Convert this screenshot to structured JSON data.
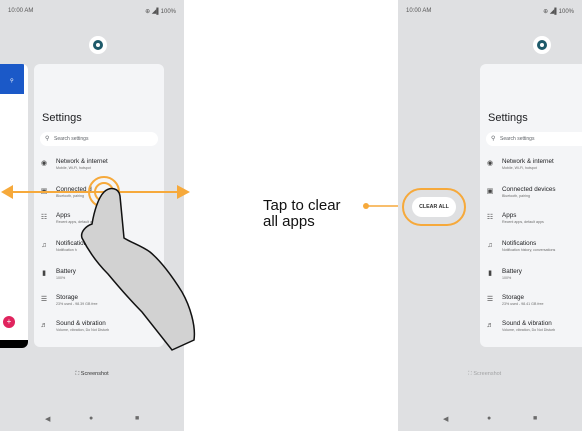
{
  "status": {
    "time": "10:00 AM",
    "icons": "⊕ ◢▌100%"
  },
  "settings": {
    "title": "Settings",
    "search_placeholder": "Search settings",
    "items": [
      {
        "title": "Network & internet",
        "subtitle": "Mobile, Wi-Fi, hotspot",
        "icon": "wifi-icon"
      },
      {
        "title": "Connected devices",
        "subtitle": "Bluetooth, pairing",
        "icon": "devices-icon"
      },
      {
        "title": "Apps",
        "subtitle": "Recent apps, default apps",
        "icon": "apps-icon"
      },
      {
        "title": "Notifications",
        "subtitle": "Notification history, conversations",
        "icon": "bell-icon"
      },
      {
        "title": "Battery",
        "subtitle": "100%",
        "icon": "battery-icon"
      },
      {
        "title": "Storage",
        "subtitle": "23% used - 98.39 GB free",
        "icon": "storage-icon"
      },
      {
        "title": "Sound & vibration",
        "subtitle": "Volume, vibration, Do Not Disturb",
        "icon": "sound-icon"
      }
    ]
  },
  "left_partial": {
    "connected_title": "Connected d",
    "connected_subtitle": "Bluetooth, pairing",
    "notifications_subtitle": "Notification h"
  },
  "right_partial": {
    "storage_subtitle": "23% used - 98.41 GB free"
  },
  "screenshot_label": "Screenshot",
  "clear_all_label": "CLEAR ALL",
  "callout": {
    "line1": "Tap to clear",
    "line2": "all apps"
  },
  "colors": {
    "accent": "#f6a93b",
    "card": "#f4f5f7",
    "bg": "#dfe0e2"
  }
}
